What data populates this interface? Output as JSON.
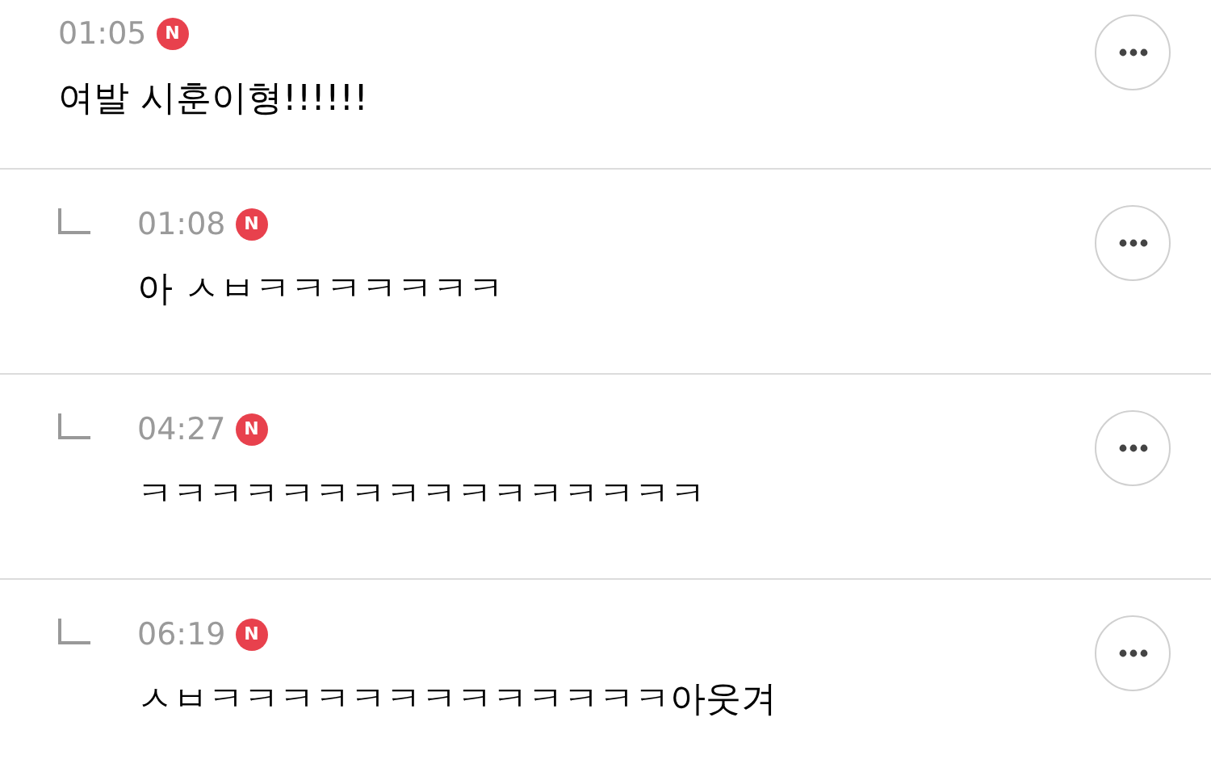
{
  "comments": [
    {
      "kind": "comment",
      "time": "01:05",
      "badge": "N",
      "text": "여발 시훈이형!!!!!!"
    },
    {
      "kind": "reply",
      "time": "01:08",
      "badge": "N",
      "text": "아 ㅅㅂㅋㅋㅋㅋㅋㅋㅋ"
    },
    {
      "kind": "reply",
      "time": "04:27",
      "badge": "N",
      "text": "ㅋㅋㅋㅋㅋㅋㅋㅋㅋㅋㅋㅋㅋㅋㅋㅋ"
    },
    {
      "kind": "reply",
      "time": "06:19",
      "badge": "N",
      "text": "ㅅㅂㅋㅋㅋㅋㅋㅋㅋㅋㅋㅋㅋㅋㅋ아웃겨"
    }
  ]
}
